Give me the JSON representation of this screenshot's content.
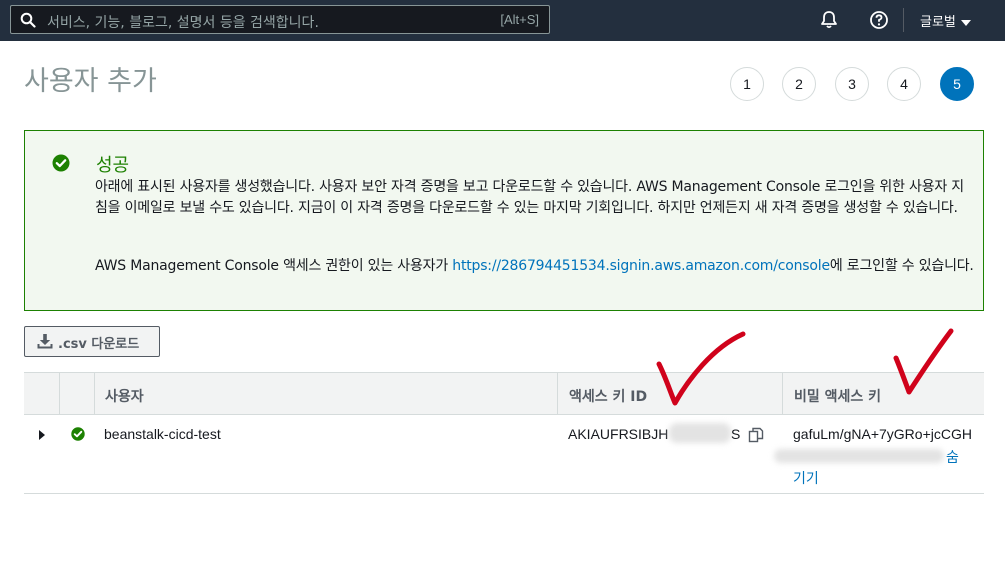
{
  "topnav": {
    "search_placeholder": "서비스, 기능, 블로그, 설명서 등을 검색합니다.",
    "search_shortcut": "[Alt+S]",
    "region_label": "글로벌",
    "icons": [
      "search-icon",
      "bell-icon",
      "help-icon",
      "caret-down-icon"
    ]
  },
  "page": {
    "title": "사용자 추가"
  },
  "steps": [
    {
      "label": "1",
      "active": false
    },
    {
      "label": "2",
      "active": false
    },
    {
      "label": "3",
      "active": false
    },
    {
      "label": "4",
      "active": false
    },
    {
      "label": "5",
      "active": true
    }
  ],
  "alert": {
    "title": "성공",
    "line1": "아래에 표시된 사용자를 생성했습니다. 사용자 보안 자격 증명을 보고 다운로드할 수 있습니다. AWS Management Console 로그인을 위한 사용자 지침을 이메일로 보낼 수도 있습니다. 지금이 이 자격 증명을 다운로드할 수 있는 마지막 기회입니다. 하지만 언제든지 새 자격 증명을 생성할 수 있습니다.",
    "line2_prefix": "AWS Management Console 액세스 권한이 있는 사용자가 ",
    "line2_link": "https://286794451534.signin.aws.amazon.com/console",
    "line2_suffix": "에 로그인할 수 있습니다."
  },
  "download_button": {
    "label": ".csv 다운로드"
  },
  "table": {
    "headers": {
      "user": "사용자",
      "access_key": "액세스 키 ID",
      "secret_key": "비밀 액세스 키"
    },
    "rows": [
      {
        "user": "beanstalk-cicd-test",
        "access_key_visible": "AKIAUFRSIBJH",
        "access_key_tail": "S",
        "secret_key_visible": "gafuLm/gNA+7yGRo+jcCGH",
        "show_link_a": "숨",
        "show_link_b": "기기"
      }
    ]
  },
  "colors": {
    "nav_bg": "#232f3e",
    "accent": "#0073bb",
    "success": "#1d8102",
    "annotation": "#d0021b"
  }
}
